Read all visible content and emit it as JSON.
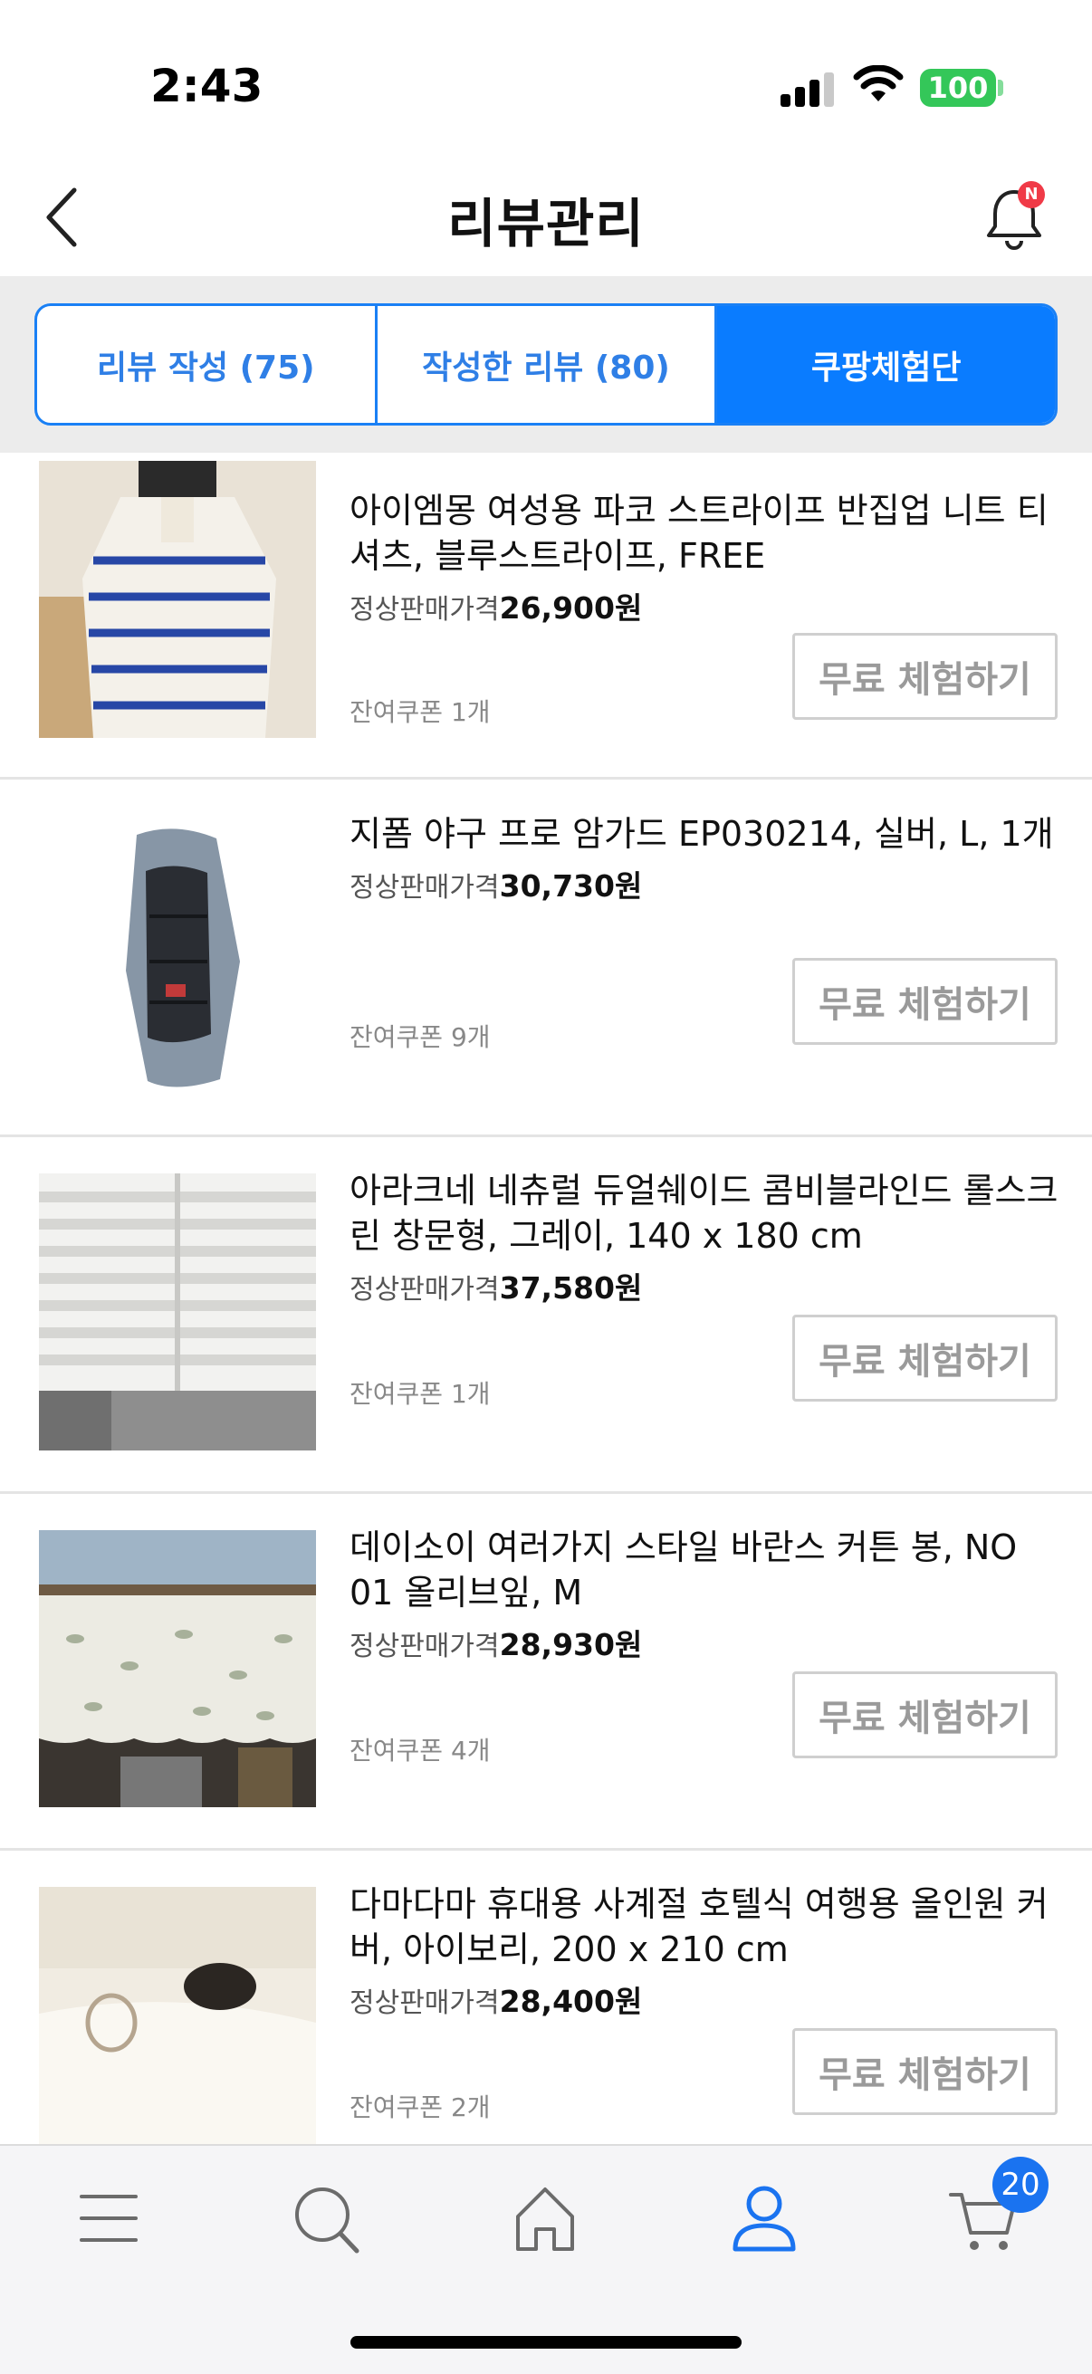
{
  "status": {
    "time": "2:43",
    "battery": "100"
  },
  "header": {
    "title": "리뷰관리",
    "notification_badge": "N"
  },
  "tabs": [
    {
      "label": "리뷰 작성 (75)",
      "active": false
    },
    {
      "label": "작성한 리뷰 (80)",
      "active": false
    },
    {
      "label": "쿠팡체험단",
      "active": true
    }
  ],
  "products": [
    {
      "name": "아이엠몽 여성용 파코 스트라이프 반집업 니트 티셔츠, 블루스트라이프, FREE",
      "price_label": "정상판매가격",
      "price": "26,900원",
      "coupon": "잔여쿠폰 1개",
      "button": "무료 체험하기",
      "image": "striped-sweater-photo"
    },
    {
      "name": "지폼 야구 프로 암가드 EP030214, 실버, L, 1개",
      "price_label": "정상판매가격",
      "price": "30,730원",
      "coupon": "잔여쿠폰 9개",
      "button": "무료 체험하기",
      "image": "arm-guard-photo"
    },
    {
      "name": "아라크네 네츄럴 듀얼쉐이드 콤비블라인드 롤스크린 창문형, 그레이, 140 x 180 cm",
      "price_label": "정상판매가격",
      "price": "37,580원",
      "coupon": "잔여쿠폰 1개",
      "button": "무료 체험하기",
      "image": "blind-photo"
    },
    {
      "name": "데이소이 여러가지 스타일 바란스 커튼 봉, NO 01 올리브잎, M",
      "price_label": "정상판매가격",
      "price": "28,930원",
      "coupon": "잔여쿠폰 4개",
      "button": "무료 체험하기",
      "image": "curtain-photo"
    },
    {
      "name": "다마다마 휴대용 사계절 호텔식 여행용 올인원 커버, 아이보리, 200 x 210 cm",
      "price_label": "정상판매가격",
      "price": "28,400원",
      "coupon": "잔여쿠폰 2개",
      "button": "무료 체험하기",
      "image": "bed-cover-photo"
    }
  ],
  "bottom_nav": {
    "items": [
      "menu-icon",
      "search-icon",
      "home-icon",
      "my-page-icon",
      "cart-icon"
    ],
    "cart_count": "20",
    "active_color": "#1a73f0"
  },
  "colors": {
    "accent": "#0a7cff",
    "tab_text": "#2f7fe6"
  }
}
